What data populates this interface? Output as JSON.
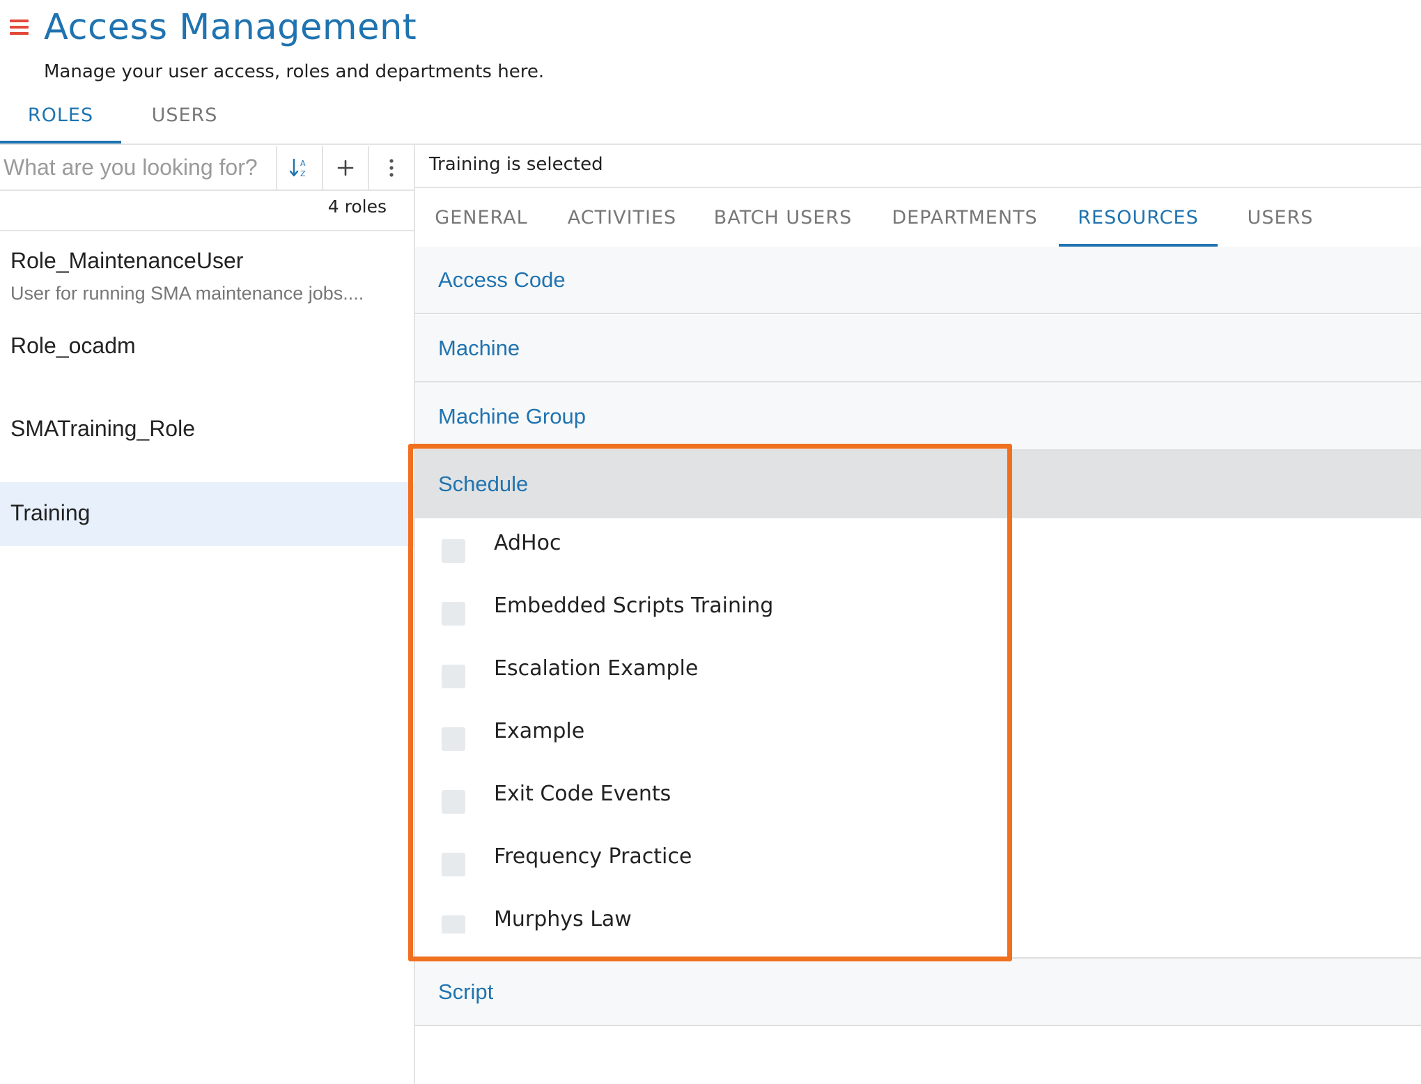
{
  "header": {
    "title": "Access Management",
    "subtitle": "Manage your user access, roles and departments here."
  },
  "top_tabs": [
    {
      "label": "ROLES",
      "active": true
    },
    {
      "label": "USERS",
      "active": false
    }
  ],
  "left_panel": {
    "search_placeholder": "What are you looking for?",
    "roles_count": "4 roles",
    "roles": [
      {
        "name": "Role_MaintenanceUser",
        "description": "User for running SMA maintenance jobs...."
      },
      {
        "name": "Role_ocadm",
        "description": ""
      },
      {
        "name": "SMATraining_Role",
        "description": ""
      },
      {
        "name": "Training",
        "description": "",
        "selected": true
      }
    ]
  },
  "right_panel": {
    "selected_info": "Training is selected",
    "tabs": [
      {
        "label": "GENERAL",
        "active": false
      },
      {
        "label": "ACTIVITIES",
        "active": false
      },
      {
        "label": "BATCH USERS",
        "active": false
      },
      {
        "label": "DEPARTMENTS",
        "active": false
      },
      {
        "label": "RESOURCES",
        "active": true
      },
      {
        "label": "USERS",
        "active": false
      }
    ],
    "resources": [
      {
        "label": "Access Code",
        "expanded": false
      },
      {
        "label": "Machine",
        "expanded": false
      },
      {
        "label": "Machine Group",
        "expanded": false
      },
      {
        "label": "Schedule",
        "expanded": true
      },
      {
        "label": "Script",
        "expanded": false
      }
    ],
    "schedule_items": [
      {
        "label": "AdHoc",
        "checked": false
      },
      {
        "label": "Embedded Scripts Training",
        "checked": false
      },
      {
        "label": "Escalation Example",
        "checked": false
      },
      {
        "label": "Example",
        "checked": false
      },
      {
        "label": "Exit Code Events",
        "checked": false
      },
      {
        "label": "Frequency Practice",
        "checked": false
      },
      {
        "label": "Murphys Law",
        "checked": false
      }
    ]
  },
  "colors": {
    "accent": "#1f73b0",
    "menu_icon": "#e2493b",
    "highlight": "#f07020",
    "selected_row": "#e8f1fb"
  }
}
